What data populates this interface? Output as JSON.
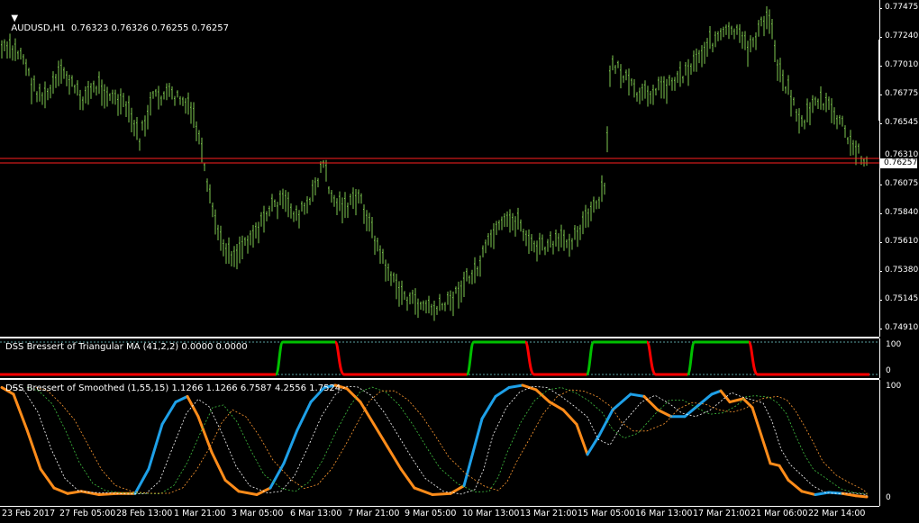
{
  "main": {
    "symbol_line": "AUDUSD,H1  0.76323 0.76326 0.76255 0.76257",
    "current_price": "0.76257",
    "hidden_price": "0.76310",
    "price_labels": [
      "0.77475",
      "0.77240",
      "0.77010",
      "0.76775",
      "0.76545",
      "0.76310",
      "0.76075",
      "0.75840",
      "0.75610",
      "0.75380",
      "0.75145",
      "0.74910"
    ]
  },
  "ind1": {
    "title": "DSS Bressert of Triangular MA (41,2,2) 0.0000 0.0000",
    "scale_top": "100",
    "scale_bottom": "0",
    "colors": {
      "up": "#00c000",
      "down": "#ff0000"
    }
  },
  "ind2": {
    "title": "DSS Bressert of Smoothed (1,55,15) 1.1266 1.1266 6.7587 4.2556 1.7524",
    "scale_top": "100",
    "scale_bottom": "0",
    "colors": {
      "up": "#1ea0e8",
      "down": "#ff8c1a",
      "signal1": "#ffffff",
      "signal2": "#40c040",
      "signal3": "#ff9a30"
    }
  },
  "time_labels": [
    "23 Feb 2017",
    "27 Feb 05:00",
    "28 Feb 13:00",
    "1 Mar 21:00",
    "3 Mar 05:00",
    "6 Mar 13:00",
    "7 Mar 21:00",
    "9 Mar 05:00",
    "10 Mar 13:00",
    "13 Mar 21:00",
    "15 Mar 05:00",
    "16 Mar 13:00",
    "17 Mar 21:00",
    "21 Mar 06:00",
    "22 Mar 14:00"
  ],
  "colors": {
    "bars": "#7ec850",
    "hline": "#ff2020"
  }
}
